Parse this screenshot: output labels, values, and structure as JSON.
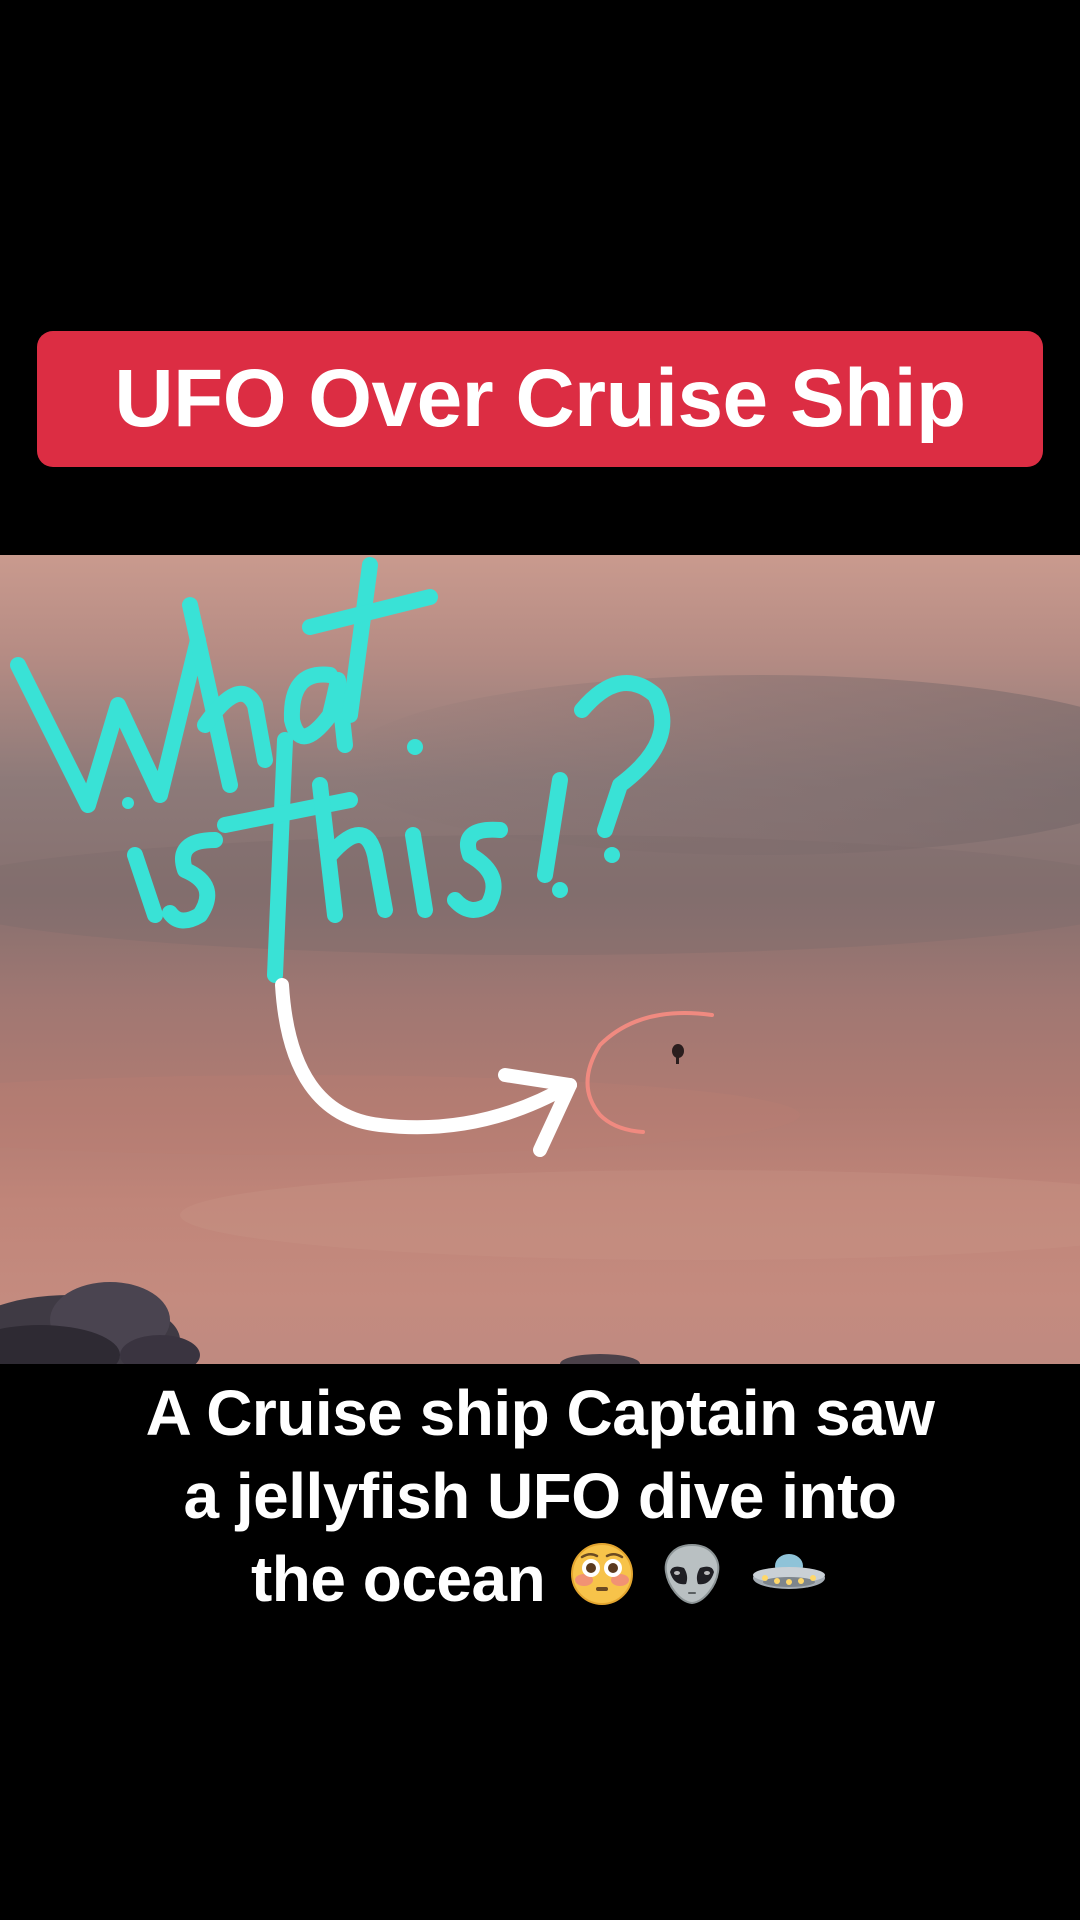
{
  "title": {
    "text": "UFO Over Cruise Ship",
    "background_color": "#dc2d43"
  },
  "video": {
    "overlay_handwriting": "What is this!?",
    "handwriting_color": "#39e2d6",
    "arrow_color": "#ffffff",
    "circle_color": "#f08a80"
  },
  "caption": {
    "line1": "A Cruise ship Captain saw",
    "line2": "a jellyfish UFO dive into",
    "line3": "the ocean",
    "emojis": [
      "flushed-face",
      "alien",
      "flying-saucer"
    ]
  }
}
